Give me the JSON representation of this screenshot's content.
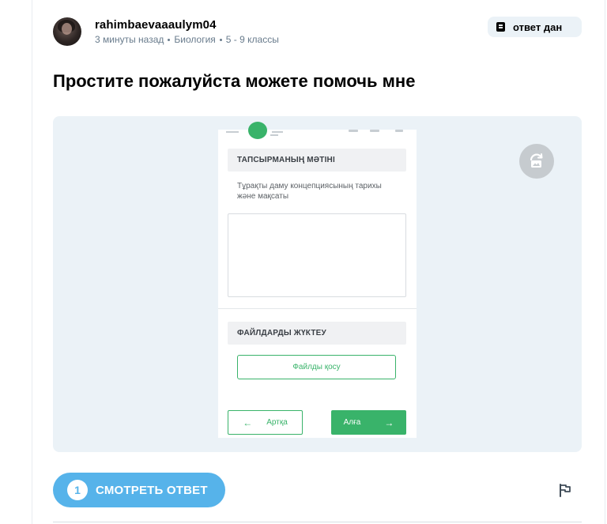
{
  "author": {
    "username": "rahimbaevaaaulym04",
    "time": "3 минуты назад",
    "subject": "Биология",
    "grade": "5 - 9 классы"
  },
  "status": {
    "label": "ответ дан",
    "icon": "answered-icon"
  },
  "question": {
    "title": "Простите пожалуйста можете помочь мне"
  },
  "attachment": {
    "task_header": "ТАПСЫРМАНЫҢ МӘТІНІ",
    "task_text": "Тұрақты даму концепциясының тарихы және мақсаты",
    "upload_header": "ФАЙЛДАРДЫ ЖҮКТЕУ",
    "upload_button": "Файлды қосу",
    "back_button": "Артқа",
    "next_button": "Алға",
    "accent_color": "#39b36a"
  },
  "actions": {
    "answer_count": "1",
    "view_answer_label": "СМОТРЕТЬ ОТВЕТ",
    "button_color": "#56b3ea"
  }
}
